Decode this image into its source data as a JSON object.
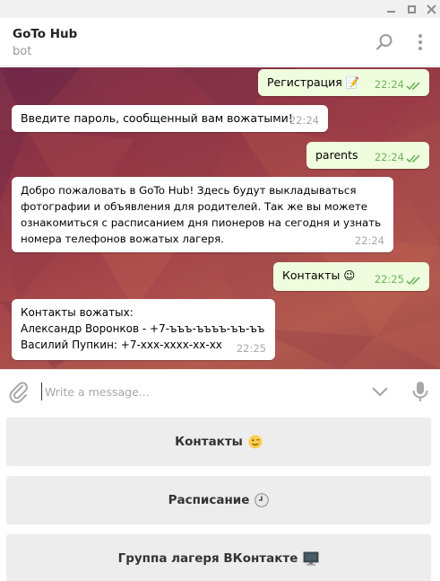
{
  "chat": {
    "title": "GoTo Hub",
    "subtitle": "bot"
  },
  "icons": {
    "search": "search-icon",
    "more": "more-vertical-icon",
    "attach": "paperclip-icon",
    "collapse": "chevron-down-icon",
    "mic": "microphone-icon"
  },
  "messages": [
    {
      "dir": "out",
      "text": "Регистрация 📝",
      "time": "22:24"
    },
    {
      "dir": "in",
      "text": "Введите пароль, сообщенный вам вожатыми!",
      "time": "22:24"
    },
    {
      "dir": "out",
      "text": "parents",
      "time": "22:24"
    },
    {
      "dir": "in",
      "lines": [
        "Добро пожаловать в GoTo Hub! Здесь будут выкладываться",
        "фотографии и объявления для родителей. Так же вы можете",
        "ознакомиться с расписанием дня пионеров на сегодня и узнать",
        "номера телефонов вожатых лагеря."
      ],
      "time": "22:24"
    },
    {
      "dir": "out",
      "text": "Контакты 😉",
      "time": "22:25"
    },
    {
      "dir": "in",
      "lines": [
        "Контакты вожатых:",
        "Александр Воронков - +7-ъъъ-ъъъъ-ъъ-ъъ",
        "Василий Пупкин: +7-xxx-xxxx-xx-xx"
      ],
      "time": "22:25"
    }
  ],
  "input": {
    "placeholder": "Write a message..."
  },
  "keyboard": [
    {
      "label": "Контакты"
    },
    {
      "label": "Расписание"
    },
    {
      "label": "Группа лагеря ВКонтакте"
    }
  ],
  "colors": {
    "outgoing": "#effdde",
    "incoming": "#ffffff",
    "check": "#6cb45b",
    "key_bg": "#ededed"
  }
}
